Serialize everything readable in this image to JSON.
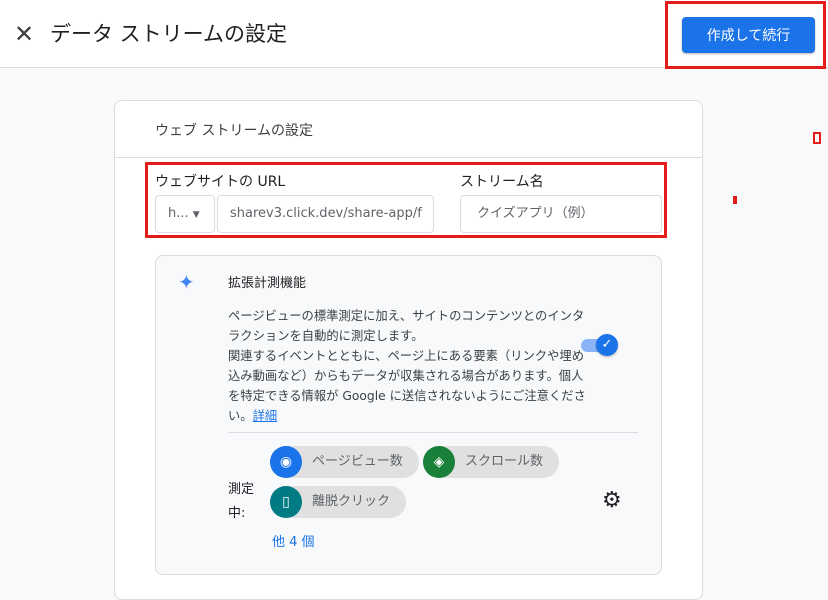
{
  "header": {
    "title": "データ ストリームの設定",
    "primary_button": "作成して続行"
  },
  "card": {
    "title": "ウェブ ストリームの設定",
    "url_label": "ウェブサイトの URL",
    "protocol_value": "h...",
    "url_value": "sharev3.click.dev/share-app/f",
    "stream_name_label": "ストリーム名",
    "stream_name_placeholder": "クイズアプリ（例）"
  },
  "enhanced": {
    "title": "拡張計測機能",
    "desc1": "ページビューの標準測定に加え、サイトのコンテンツとのインタラクションを自動的に測定します。",
    "desc2": "関連するイベントとともに、ページ上にある要素（リンクや埋め込み動画など）からもデータが収集される場合があります。個人を特定できる情報が Google に送信されないようにご注意ください。",
    "link": "詳細",
    "toggle_on": true,
    "measuring_label": "測定中:",
    "chips": [
      {
        "label": "ページビュー数",
        "icon": "eye-icon",
        "color": "#1a73e8"
      },
      {
        "label": "スクロール数",
        "icon": "scroll-icon",
        "color": "#188038"
      },
      {
        "label": "離脱クリック",
        "icon": "mouse-icon",
        "color": "#007b83"
      }
    ],
    "more": "他 4 個"
  }
}
